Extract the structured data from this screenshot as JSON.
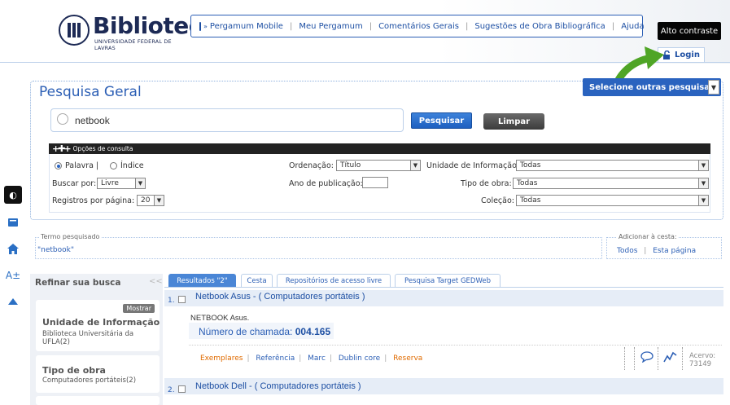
{
  "header": {
    "logo_title": "Biblioteca",
    "logo_subtitle": "UNIVERSIDADE FEDERAL DE LAVRAS",
    "nav": [
      {
        "label": "Pergamum Mobile"
      },
      {
        "label": "Meu Pergamum"
      },
      {
        "label": "Comentários Gerais"
      },
      {
        "label": "Sugestões de Obra Bibliográfica"
      },
      {
        "label": "Ajuda"
      }
    ],
    "contrast_label": "Alto contraste",
    "login_label": "Login"
  },
  "rail": {
    "contrast_glyph": "◐",
    "font_size_label": "A±"
  },
  "search": {
    "title": "Pesquisa Geral",
    "other_searches_label": "Selecione outras pesquisas",
    "query": "netbook",
    "search_button": "Pesquisar",
    "clear_button": "Limpar",
    "options_title": "Opções de consulta",
    "radio_palavra": "Palavra |",
    "radio_indice": "Índice",
    "buscar_por_label": "Buscar por:",
    "buscar_por_value": "Livre",
    "registros_label": "Registros por página:",
    "registros_value": "20",
    "ordenacao_label": "Ordenação:",
    "ordenacao_value": "Título",
    "ano_label": "Ano de publicação:",
    "ano_value": "",
    "unidade_label": "Unidade de Informação:",
    "unidade_value": "Todas",
    "tipo_label": "Tipo de obra:",
    "tipo_value": "Todas",
    "colecao_label": "Coleção:",
    "colecao_value": "Todas"
  },
  "term": {
    "legend": "Termo pesquisado",
    "value": "\"netbook\"",
    "cesta_legend": "Adicionar à cesta:",
    "cesta_all": "Todos",
    "cesta_page": "Esta página"
  },
  "refine": {
    "title": "Refinar sua busca",
    "collapse": "<<",
    "mostrar": "Mostrar",
    "groups": [
      {
        "title": "Unidade de Informação",
        "item": "Biblioteca Universitária da UFLA(2)"
      },
      {
        "title": "Tipo de obra",
        "item": "Computadores portáteis(2)"
      }
    ]
  },
  "tabs": [
    {
      "label": "Resultados \"2\"",
      "active": true
    },
    {
      "label": "Cesta",
      "active": false
    },
    {
      "label": "Repositórios de acesso livre",
      "active": false
    },
    {
      "label": "Pesquisa Target GEDWeb",
      "active": false
    }
  ],
  "results": [
    {
      "num": "1.",
      "title": "Netbook Asus - ( Computadores portáteis )",
      "desc": "NETBOOK Asus.",
      "callnum_label": "Número de chamada:",
      "callnum_value": "004.165",
      "actions": [
        "Exemplares",
        "Referência",
        "Marc",
        "Dublin core",
        "Reserva"
      ],
      "acervo_label": "Acervo:",
      "acervo_value": "73149"
    },
    {
      "num": "2.",
      "title": "Netbook Dell - ( Computadores portáteis )"
    }
  ]
}
